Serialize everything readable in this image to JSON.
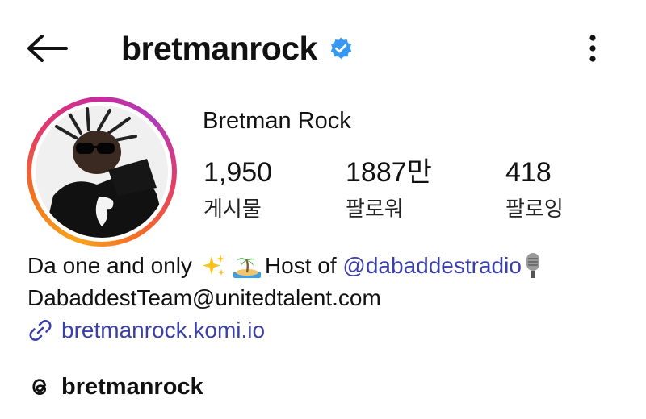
{
  "header": {
    "username": "bretmanrock",
    "back_icon": "arrow-left-icon",
    "verified_icon": "verified-badge-icon",
    "more_icon": "more-vertical-icon",
    "verified_color": "#3897f0"
  },
  "profile": {
    "display_name": "Bretman Rock",
    "avatar_ring_colors": [
      "#f9a31b",
      "#e33b6a",
      "#b13ab8"
    ],
    "stats": [
      {
        "value": "1,950",
        "label": "게시물"
      },
      {
        "value": "1887만",
        "label": "팔로워"
      },
      {
        "value": "418",
        "label": "팔로잉"
      }
    ]
  },
  "bio": {
    "line1_text": "Da one and only",
    "line1_emoji1": "sparkles-icon",
    "line1_emoji2": "desert-island-icon",
    "line1_host": "Host of ",
    "mention": "@dabaddestradio",
    "line1_emoji3": "microphone-icon",
    "line2": "DabaddestTeam@unitedtalent.com",
    "link_icon": "link-icon",
    "link": "bretmanrock.komi.io",
    "link_color": "#3a3faa"
  },
  "threads": {
    "icon": "threads-icon",
    "label": "bretmanrock"
  }
}
